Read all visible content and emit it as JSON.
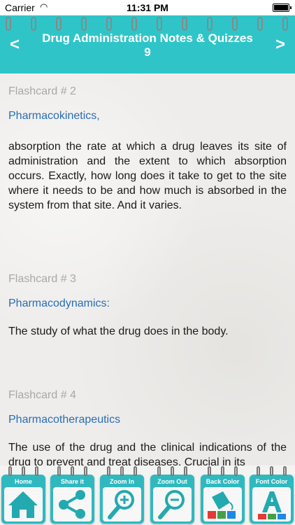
{
  "status_bar": {
    "carrier": "Carrier",
    "time": "11:31 PM"
  },
  "header": {
    "title_line1": "Drug Administration Notes & Quizzes",
    "title_line2": "9",
    "prev_label": "<",
    "next_label": ">"
  },
  "cards": [
    {
      "number": "Flashcard # 2",
      "term": "Pharmacokinetics,",
      "definition": "absorption the rate at which a drug leaves its site of administration and the extent to which absorption occurs. Exactly, how long does it take to get to the site where it needs to be and how much is absorbed in the system from that site. And it varies."
    },
    {
      "number": "Flashcard # 3",
      "term": "Pharmacodynamics:",
      "definition": "The study of what the drug does in the body."
    },
    {
      "number": "Flashcard # 4",
      "term": "Pharmacotherapeutics",
      "definition": "The use of the drug and the clinical indications of the drug to prevent and treat diseases. Crucial in its"
    }
  ],
  "toolbar": {
    "items": [
      {
        "label": "Home",
        "icon": "home-icon"
      },
      {
        "label": "Share it",
        "icon": "share-icon"
      },
      {
        "label": "Zoom In",
        "icon": "zoom-in-icon"
      },
      {
        "label": "Zoom Out",
        "icon": "zoom-out-icon"
      },
      {
        "label": "Back Color",
        "icon": "paint-bucket-icon"
      },
      {
        "label": "Font Color",
        "icon": "font-color-icon"
      }
    ]
  },
  "colors": {
    "accent": "#2fc5c8",
    "term": "#2a6db4",
    "muted": "#a8a8a8"
  }
}
